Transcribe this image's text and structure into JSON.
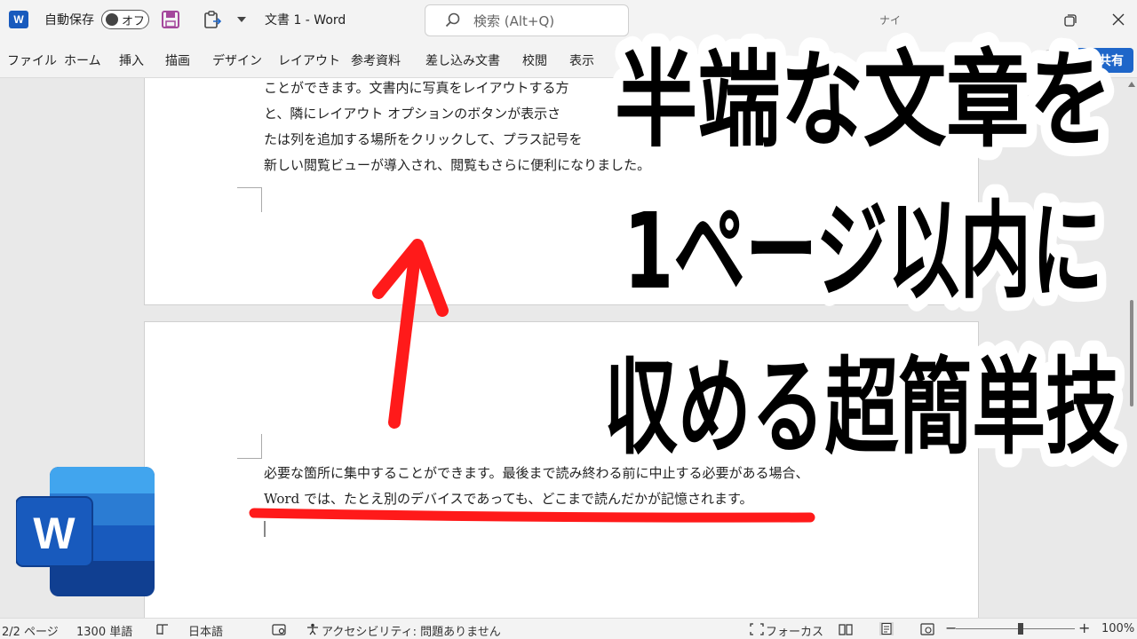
{
  "titlebar": {
    "app_icon_letter": "W",
    "autosave_label": "自動保存",
    "autosave_state": "オフ",
    "document_title": "文書 1 - Word",
    "search_placeholder": "検索 (Alt+Q)",
    "truncated_signin": "ナイ"
  },
  "ribbon": {
    "tabs": [
      "ファイル",
      "ホーム",
      "挿入",
      "描画",
      "デザイン",
      "レイアウト",
      "参考資料",
      "差し込み文書",
      "校閲",
      "表示"
    ],
    "share_label": "共有"
  },
  "document": {
    "page1_lines": [
      "ことができます。文書内に写真をレイアウトする方",
      "と、隣にレイアウト オプションのボタンが表示さ",
      "たは列を追加する場所をクリックして、プラス記号を",
      "新しい閲覧ビューが導入され、閲覧もさらに便利になりました。"
    ],
    "page2_lines": [
      "必要な箇所に集中することができます。最後まで読み終わる前に中止する必要がある場合、",
      "Word では、たとえ別のデバイスであっても、どこまで読んだかが記憶されます。"
    ]
  },
  "overlay": {
    "caption_lines": [
      "半端な文章を",
      "1ページ以内に",
      "収める超簡単技"
    ],
    "arrow_color": "#ff1a1a",
    "underline_color": "#ff1a1a"
  },
  "big_logo_letter": "W",
  "statusbar": {
    "page": "2/2 ページ",
    "words": "1300 単語",
    "language": "日本語",
    "accessibility": "アクセシビリティ: 問題ありません",
    "focus": "フォーカス",
    "zoom": "100%"
  },
  "colors": {
    "accent": "#1e66c9",
    "word_blue": "#185abd",
    "save_icon": "#a4489c"
  }
}
